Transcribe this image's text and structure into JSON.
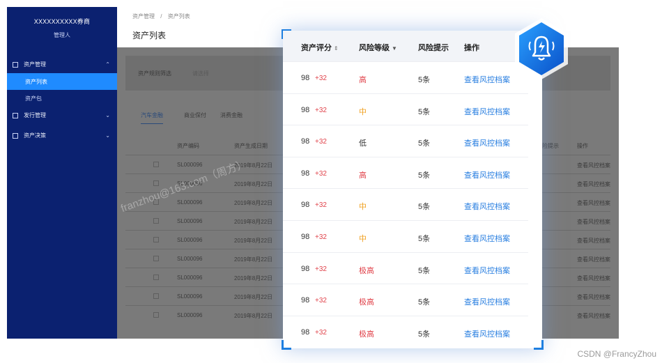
{
  "sidebar": {
    "brand": "XXXXXXXXXX券商",
    "role": "管理人",
    "menu": [
      {
        "label": "资产管理",
        "chevron": "up"
      },
      {
        "label": "资产列表",
        "active": true
      },
      {
        "label": "资产包"
      },
      {
        "label": "发行管理",
        "chevron": "down"
      },
      {
        "label": "资产决策",
        "chevron": "down"
      }
    ]
  },
  "breadcrumb": {
    "item1": "资产管理",
    "sep": "/",
    "item2": "资产列表"
  },
  "page_title": "资产列表",
  "filter": {
    "label": "资产规则筛选",
    "placeholder": "请选择"
  },
  "tabs": [
    "汽车金融",
    "商业保付",
    "消费金融"
  ],
  "bg_table": {
    "headers": [
      "资产编码",
      "资产生成日期",
      "风险提示",
      "操作"
    ],
    "rows": [
      {
        "code": "SL000096",
        "date": "2019年8月22日",
        "action": "查看风控档案"
      },
      {
        "code": "SL000096",
        "date": "2019年8月22日",
        "action": "查看风控档案"
      },
      {
        "code": "SL000096",
        "date": "2019年8月22日",
        "action": "查看风控档案"
      },
      {
        "code": "SL000096",
        "date": "2019年8月22日",
        "action": "查看风控档案"
      },
      {
        "code": "SL000096",
        "date": "2019年8月22日",
        "action": "查看风控档案"
      },
      {
        "code": "SL000096",
        "date": "2019年8月22日",
        "action": "查看风控档案"
      },
      {
        "code": "SL000096",
        "date": "2019年8月22日",
        "action": "查看风控档案"
      },
      {
        "code": "SL000096",
        "date": "2019年8月22日",
        "action": "查看风控档案"
      },
      {
        "code": "SL000096",
        "date": "2019年8月22日",
        "action": "查看风控档案"
      }
    ]
  },
  "card": {
    "headers": {
      "score": "资产评分",
      "level": "风险等级",
      "hint": "风险提示",
      "action": "操作"
    },
    "sort_icon": "⇕",
    "filter_icon": "▼",
    "rows": [
      {
        "score": "98",
        "delta": "+32",
        "level": "高",
        "level_class": "lv-high",
        "hint": "5条",
        "action": "查看风控档案"
      },
      {
        "score": "98",
        "delta": "+32",
        "level": "中",
        "level_class": "lv-mid",
        "hint": "5条",
        "action": "查看风控档案"
      },
      {
        "score": "98",
        "delta": "+32",
        "level": "低",
        "level_class": "lv-low",
        "hint": "5条",
        "action": "查看风控档案"
      },
      {
        "score": "98",
        "delta": "+32",
        "level": "高",
        "level_class": "lv-high",
        "hint": "5条",
        "action": "查看风控档案"
      },
      {
        "score": "98",
        "delta": "+32",
        "level": "中",
        "level_class": "lv-mid",
        "hint": "5条",
        "action": "查看风控档案"
      },
      {
        "score": "98",
        "delta": "+32",
        "level": "中",
        "level_class": "lv-mid",
        "hint": "5条",
        "action": "查看风控档案"
      },
      {
        "score": "98",
        "delta": "+32",
        "level": "极高",
        "level_class": "lv-xhigh",
        "hint": "5条",
        "action": "查看风控档案"
      },
      {
        "score": "98",
        "delta": "+32",
        "level": "极高",
        "level_class": "lv-xhigh",
        "hint": "5条",
        "action": "查看风控档案"
      },
      {
        "score": "98",
        "delta": "+32",
        "level": "极高",
        "level_class": "lv-xhigh",
        "hint": "5条",
        "action": "查看风控档案"
      }
    ]
  },
  "watermark": "franzhou@163.com（周方）",
  "csdn_credit": "CSDN @FrancyZhou",
  "colors": {
    "sidebar": "#0b2170",
    "active": "#1f8bff",
    "accent": "#2a7fe0",
    "danger": "#e0424a",
    "warn": "#f0a020"
  },
  "badge_icon": "bell-alert-icon"
}
